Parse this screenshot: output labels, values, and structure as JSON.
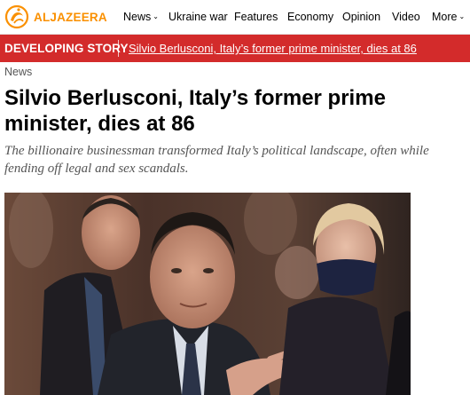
{
  "site": {
    "logo_text": "ALJAZEERA",
    "logo_icon": "aljazeera-logo-icon",
    "brand_color": "#fa9000"
  },
  "nav": {
    "items": [
      {
        "label": "News",
        "has_dropdown": true
      },
      {
        "label": "Ukraine war",
        "has_dropdown": false
      },
      {
        "label": "Features",
        "has_dropdown": false
      },
      {
        "label": "Economy",
        "has_dropdown": false
      },
      {
        "label": "Opinion",
        "has_dropdown": false
      },
      {
        "label": "Video",
        "has_dropdown": false
      },
      {
        "label": "More",
        "has_dropdown": true
      }
    ],
    "dropdown_icon": "chevron-down-icon"
  },
  "developing": {
    "label": "DEVELOPING STORY",
    "link": "Silvio Berlusconi, Italy’s former prime minister, dies at 86",
    "bar_color": "#d32b2b"
  },
  "article": {
    "category": "News",
    "title": "Silvio Berlusconi, Italy’s former prime minister, dies at 86",
    "subtitle": "The billionaire businessman transformed Italy’s political landscape, often while fending off legal and sex scandals."
  }
}
